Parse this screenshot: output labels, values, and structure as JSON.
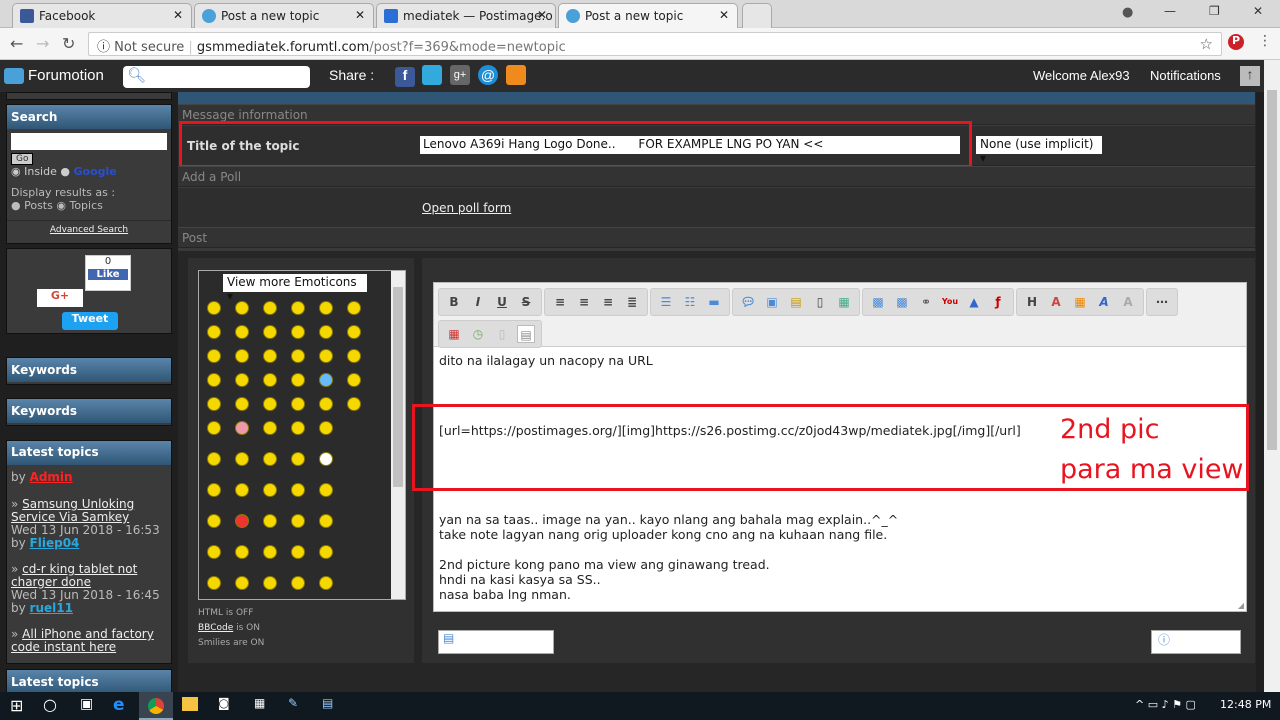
{
  "browser": {
    "tabs": [
      {
        "label": "Facebook",
        "color": "#3b5998"
      },
      {
        "label": "Post a new topic",
        "color": "#4aa0d8"
      },
      {
        "label": "mediatek — Postimage.o",
        "color": "#2b6fd6"
      },
      {
        "label": "Post a new topic",
        "color": "#4aa0d8"
      }
    ],
    "security": "Not secure",
    "url_host": "gsmmediatek.forumtl.com",
    "url_path": "/post?f=369&mode=newtopic"
  },
  "toolbar": {
    "brand": "Forumotion",
    "share": "Share :",
    "welcome": "Welcome Alex93",
    "notifications": "Notifications"
  },
  "sidebar": {
    "search_title": "Search",
    "go": "Go",
    "inside": "Inside",
    "google": "Google",
    "display_as": "Display results as :",
    "posts": "Posts",
    "topics": "Topics",
    "advanced": "Advanced Search",
    "like_count": "0",
    "like": "Like",
    "gplus": "G+",
    "tweet": "Tweet",
    "keywords1": "Keywords",
    "keywords2": "Keywords",
    "latest": "Latest topics",
    "latest2": "Latest topics",
    "by": "by",
    "first_author": "Admin",
    "topics_list": [
      {
        "title": "Samsung Unloking Service Via Samkey",
        "date": "Wed 13 Jun 2018 - 16:53",
        "author": "Fliep04"
      },
      {
        "title": "cd-r king tablet not charger done ",
        "date": "Wed 13 Jun 2018 - 16:45",
        "author": "ruel11"
      },
      {
        "title": "All iPhone and factory code instant here"
      }
    ]
  },
  "form": {
    "message_info": "Message information",
    "title_label": "Title of the topic",
    "title_value": "Lenovo A369i Hang Logo Done..      FOR EXAMPLE LNG PO YAN <<",
    "icon_select": "None (use implicit)",
    "add_poll": "Add a Poll",
    "open_poll": "Open poll form",
    "post": "Post",
    "more_emoticons": "View more Emoticons",
    "html_status": "HTML is OFF",
    "bbcode": "BBCode",
    "bbcode_status": " is ON",
    "smilies_status": "Smilies are ON"
  },
  "editor": {
    "line1": "dito na ilalagay un nacopy na URL",
    "bbcode_line": "[url=https://postimages.org/][img]https://s26.postimg.cc/z0jod43wp/mediatek.jpg[/img][/url]",
    "lines": [
      "yan na sa taas.. image na yan.. kayo nlang ang bahala mag explain..^_^",
      "take note lagyan nang orig uploader kong cno ang na kuhaan nang file.",
      "",
      "2nd picture kong pano ma view ang ginawang tread.",
      "hndi na kasi kasya sa SS..",
      "nasa baba lng nman."
    ]
  },
  "annotation": {
    "line1": "2nd pic",
    "line2": "para ma view",
    "color": "#e8141f"
  },
  "taskbar": {
    "time": "12:48 PM"
  }
}
